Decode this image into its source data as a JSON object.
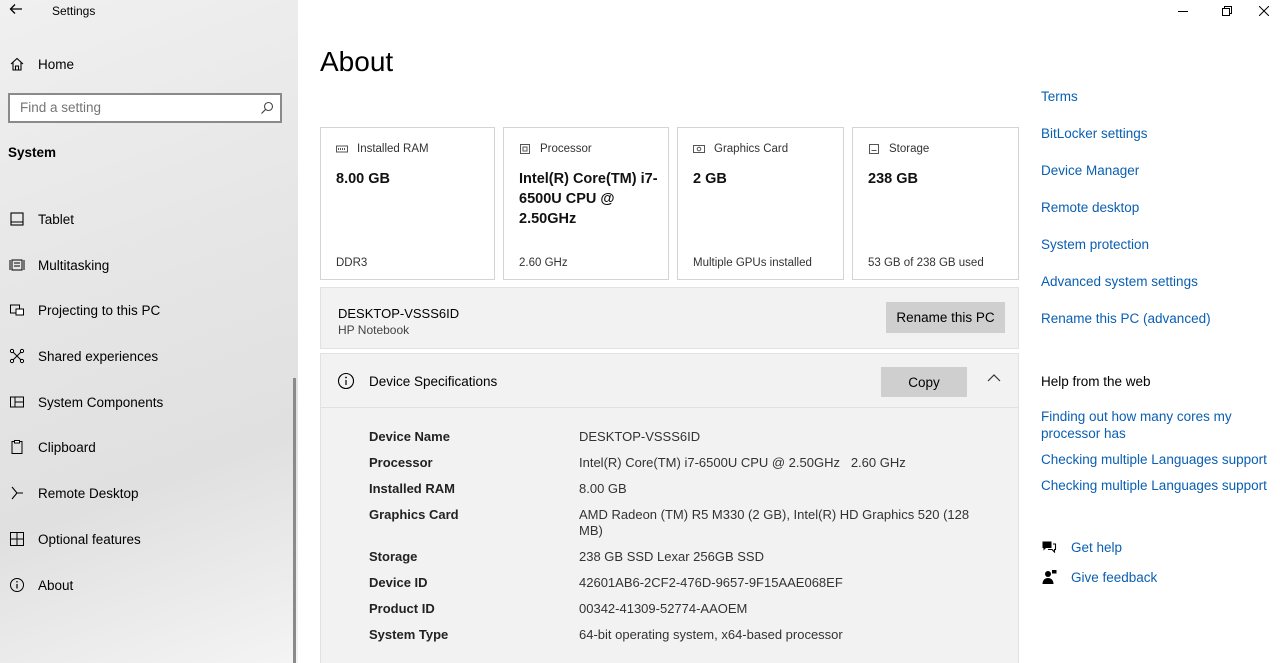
{
  "window": {
    "title": "Settings"
  },
  "sidebar": {
    "home_label": "Home",
    "search_placeholder": "Find a setting",
    "section_title": "System",
    "items": [
      {
        "label": "Tablet",
        "icon": "tablet-icon"
      },
      {
        "label": "Multitasking",
        "icon": "multitasking-icon"
      },
      {
        "label": "Projecting to this PC",
        "icon": "projecting-icon"
      },
      {
        "label": "Shared experiences",
        "icon": "shared-icon"
      },
      {
        "label": "System Components",
        "icon": "components-icon"
      },
      {
        "label": "Clipboard",
        "icon": "clipboard-icon"
      },
      {
        "label": "Remote Desktop",
        "icon": "remote-desktop-icon"
      },
      {
        "label": "Optional features",
        "icon": "optional-features-icon"
      },
      {
        "label": "About",
        "icon": "info-icon"
      }
    ]
  },
  "main": {
    "title": "About",
    "cards": [
      {
        "label": "Installed RAM",
        "value": "8.00 GB",
        "foot": "DDR3"
      },
      {
        "label": "Processor",
        "value": "Intel(R) Core(TM) i7-6500U CPU @ 2.50GHz",
        "foot": "2.60 GHz"
      },
      {
        "label": "Graphics Card",
        "value": "2 GB",
        "foot": "Multiple GPUs installed"
      },
      {
        "label": "Storage",
        "value": "238 GB",
        "foot": "53 GB of 238 GB used"
      }
    ],
    "pc": {
      "name": "DESKTOP-VSSS6ID",
      "model": "HP Notebook",
      "rename_label": "Rename this PC"
    },
    "specs": {
      "title": "Device Specifications",
      "copy_label": "Copy",
      "rows": [
        {
          "key": "Device Name",
          "value": "DESKTOP-VSSS6ID"
        },
        {
          "key": "Processor",
          "value": "Intel(R) Core(TM) i7-6500U CPU @ 2.50GHz   2.60 GHz"
        },
        {
          "key": "Installed RAM",
          "value": "8.00 GB"
        },
        {
          "key": "Graphics Card",
          "value": "AMD Radeon (TM) R5 M330 (2 GB), Intel(R) HD Graphics 520 (128 MB)"
        },
        {
          "key": "Storage",
          "value": "238 GB SSD Lexar 256GB SSD"
        },
        {
          "key": "Device ID",
          "value": "42601AB6-2CF2-476D-9657-9F15AAE068EF"
        },
        {
          "key": "Product ID",
          "value": "00342-41309-52774-AAOEM"
        },
        {
          "key": "System Type",
          "value": "64-bit operating system, x64-based processor"
        }
      ]
    }
  },
  "right": {
    "links": [
      "Terms",
      "BitLocker settings",
      "Device Manager",
      "Remote desktop",
      "System protection",
      "Advanced system settings",
      "Rename this PC (advanced)"
    ],
    "help_title": "Help from the web",
    "help_links": [
      "Finding out how many cores my processor has",
      "Checking multiple Languages support",
      "Checking multiple Languages support"
    ],
    "get_help": "Get help",
    "give_feedback": "Give feedback"
  },
  "colors": {
    "link": "#0a5fb2",
    "button": "#cfcfcf",
    "panel": "#f2f2f2"
  }
}
